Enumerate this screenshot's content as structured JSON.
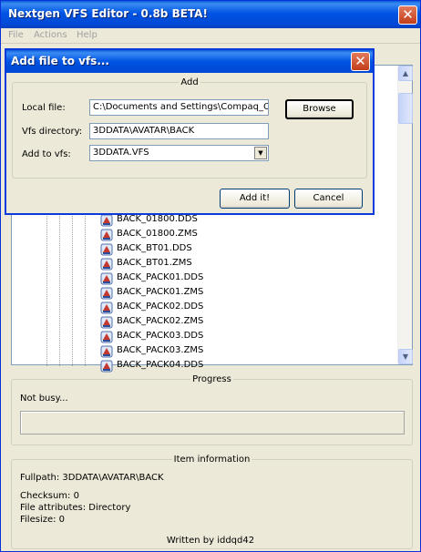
{
  "window": {
    "title": "Nextgen VFS Editor - 0.8b BETA!"
  },
  "menu": [
    "File",
    "Actions",
    "Help"
  ],
  "tree": {
    "files": [
      "BACK_01800.DDS",
      "BACK_01800.ZMS",
      "BACK_BT01.DDS",
      "BACK_BT01.ZMS",
      "BACK_PACK01.DDS",
      "BACK_PACK01.ZMS",
      "BACK_PACK02.DDS",
      "BACK_PACK02.ZMS",
      "BACK_PACK03.DDS",
      "BACK_PACK03.ZMS",
      "BACK_PACK04.DDS"
    ]
  },
  "dialog": {
    "title": "Add file to vfs...",
    "group_label": "Add",
    "local_file_label": "Local file:",
    "local_file_value": "C:\\Documents and Settings\\Compaq_Ow",
    "vfs_dir_label": "Vfs directory:",
    "vfs_dir_value": "3DDATA\\AVATAR\\BACK",
    "add_to_vfs_label": "Add to vfs:",
    "add_to_vfs_value": "3DDATA.VFS",
    "browse_label": "Browse",
    "add_label": "Add it!",
    "cancel_label": "Cancel"
  },
  "progress": {
    "group_label": "Progress",
    "status": "Not busy...",
    "value": 0
  },
  "item_info": {
    "group_label": "Item information",
    "fullpath": "Fullpath: 3DDATA\\AVATAR\\BACK",
    "checksum": "Checksum: 0",
    "attributes": "File attributes: Directory",
    "filesize": "Filesize: 0"
  },
  "footer": "Written by iddqd42"
}
